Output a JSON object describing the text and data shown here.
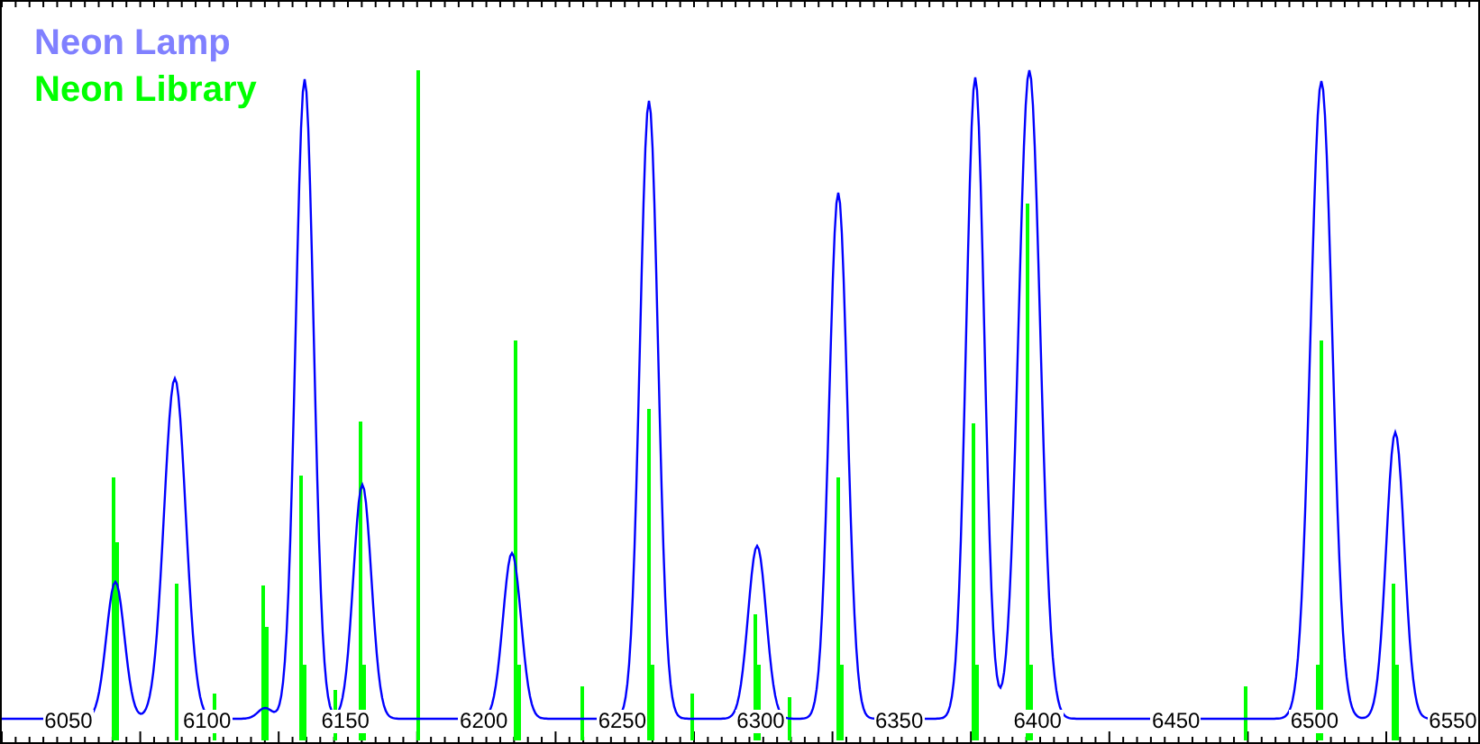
{
  "legend": [
    {
      "label": "Neon Lamp",
      "color": "#8080ff"
    },
    {
      "label": "Neon Library",
      "color": "#00ff00"
    }
  ],
  "x_axis": {
    "tick_labels": [
      "6050",
      "6100",
      "6150",
      "6200",
      "6250",
      "6300",
      "6350",
      "6400",
      "6450",
      "6500",
      "6550"
    ]
  }
}
